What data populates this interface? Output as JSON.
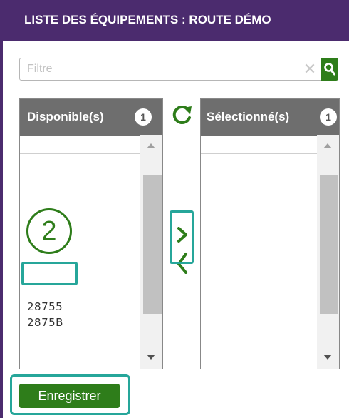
{
  "header": {
    "title": "LISTE DES ÉQUIPEMENTS : ROUTE DÉMO"
  },
  "filter": {
    "placeholder": "Filtre",
    "value": "",
    "clear_icon": "close-icon",
    "search_icon": "search-icon"
  },
  "available": {
    "label": "Disponible(s)",
    "count": "1",
    "items": [
      "28755",
      "2875B"
    ]
  },
  "selected": {
    "label": "Sélectionné(s)",
    "count": "1",
    "items": []
  },
  "step_marker": "2",
  "actions": {
    "save_label": "Enregistrer"
  },
  "colors": {
    "header_bg": "#4b2b6e",
    "accent_green": "#2e7d1a",
    "highlight_teal": "#26a69a",
    "panel_header_bg": "#6e6e6e"
  },
  "icons": {
    "refresh": "refresh-icon",
    "move_right": "chevron-right-icon",
    "move_left": "chevron-left-icon"
  }
}
